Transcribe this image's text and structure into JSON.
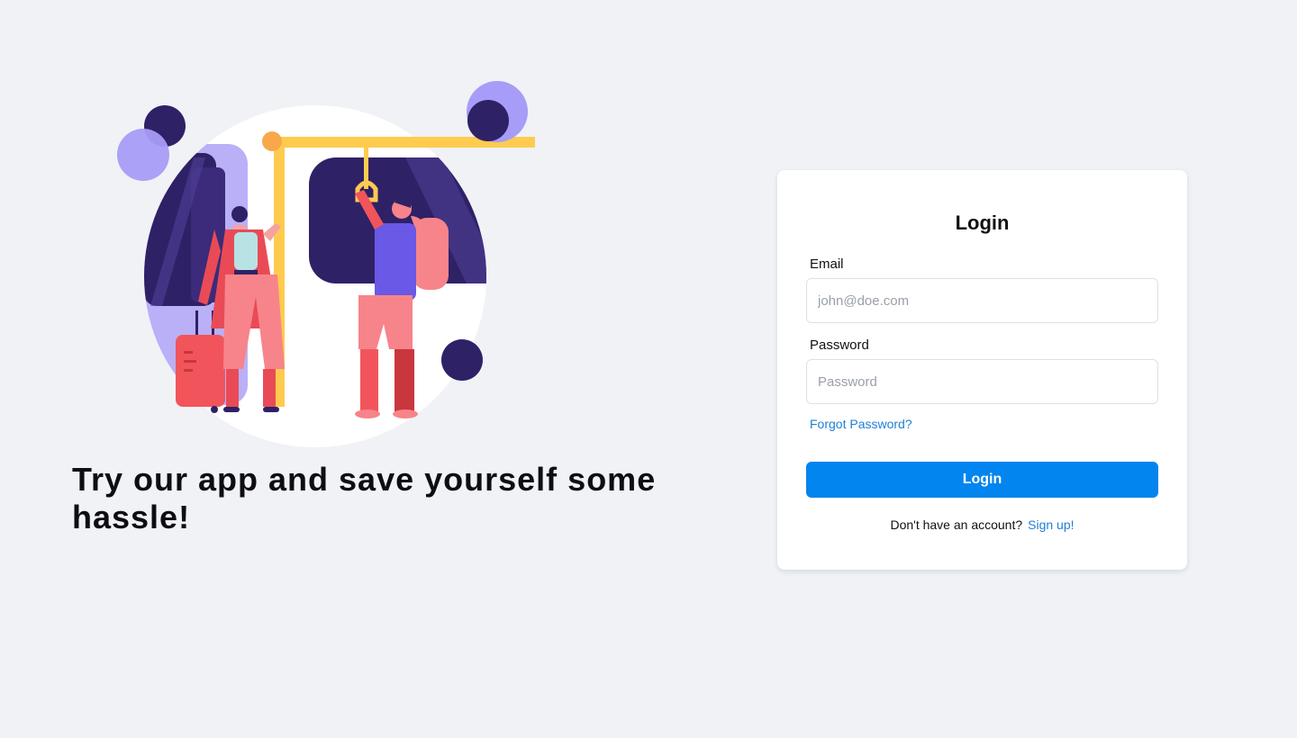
{
  "hero": {
    "tagline": "Try our app and save yourself some hassle!",
    "illustration": "commuters-on-train-illustration"
  },
  "login": {
    "title": "Login",
    "email_label": "Email",
    "email_placeholder": "john@doe.com",
    "password_label": "Password",
    "password_placeholder": "Password",
    "forgot_password": "Forgot Password?",
    "submit_label": "Login",
    "signup_prompt": "Don't have an account?",
    "signup_link": "Sign up!"
  },
  "colors": {
    "background": "#f0f2f6",
    "accent": "#0285ef",
    "link": "#1f7fd6",
    "illustration_purple_dark": "#2f2166",
    "illustration_purple_light": "#a79cf7",
    "illustration_yellow": "#ffcb4f",
    "illustration_coral": "#f2545b"
  }
}
